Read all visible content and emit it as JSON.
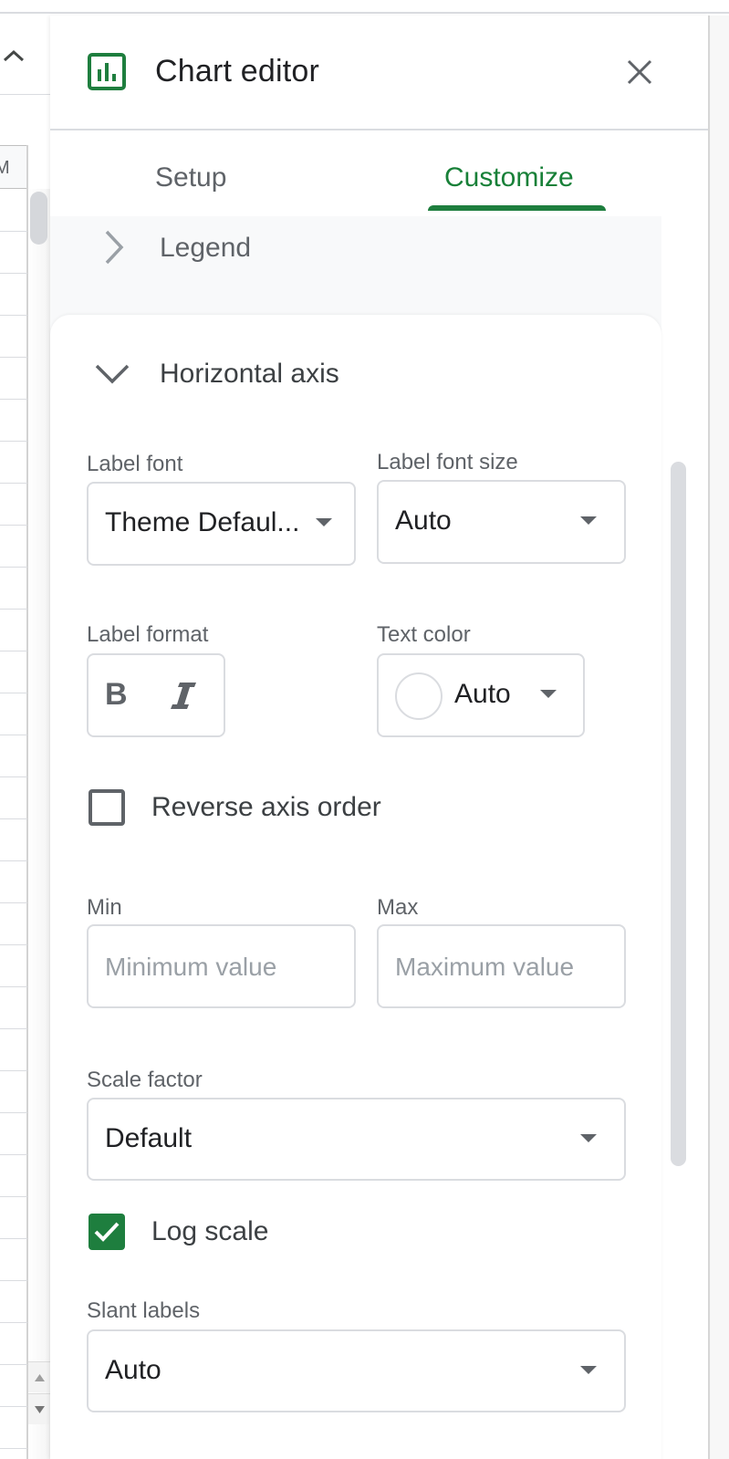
{
  "spreadsheet": {
    "column_header": "M",
    "icons": {
      "collapse": "chevron-up-icon",
      "scroll_up": "scroll-up-arrow-icon",
      "scroll_down": "scroll-down-arrow-icon"
    }
  },
  "editor": {
    "title": "Chart editor",
    "icons": {
      "app": "bar-chart-icon",
      "close": "close-icon"
    },
    "accent_color": "#1e7e3e",
    "tabs": [
      {
        "label": "Setup",
        "active": false
      },
      {
        "label": "Customize",
        "active": true
      }
    ],
    "sections": {
      "legend": {
        "label": "Legend",
        "expanded": false,
        "icon": "chevron-right-icon"
      },
      "horizontal_axis": {
        "label": "Horizontal axis",
        "expanded": true,
        "icon": "chevron-down-icon"
      }
    },
    "fields": {
      "label_font": {
        "label": "Label font",
        "value": "Theme Defaul..."
      },
      "label_font_size": {
        "label": "Label font size",
        "value": "Auto"
      },
      "label_format": {
        "label": "Label format",
        "bold_icon": "bold-icon",
        "italic_icon": "italic-icon"
      },
      "text_color": {
        "label": "Text color",
        "value": "Auto",
        "swatch_color": "#ffffff"
      },
      "reverse_axis_order": {
        "label": "Reverse axis order",
        "checked": false
      },
      "min": {
        "label": "Min",
        "placeholder": "Minimum value",
        "value": ""
      },
      "max": {
        "label": "Max",
        "placeholder": "Maximum value",
        "value": ""
      },
      "scale_factor": {
        "label": "Scale factor",
        "value": "Default"
      },
      "log_scale": {
        "label": "Log scale",
        "checked": true
      },
      "slant_labels": {
        "label": "Slant labels",
        "value": "Auto"
      }
    }
  }
}
